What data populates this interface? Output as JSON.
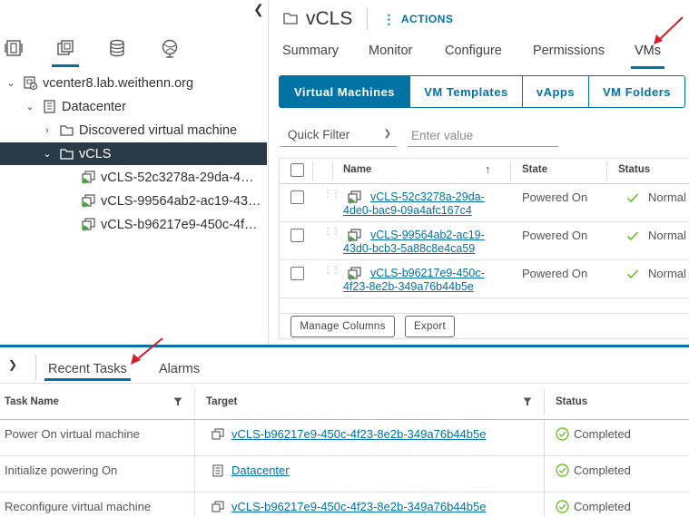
{
  "navigator": {
    "icons": [
      "hosts-and-clusters-icon",
      "vms-and-templates-icon",
      "storage-icon",
      "networking-icon"
    ],
    "tree": [
      {
        "label": "vcenter8.lab.weithenn.org",
        "type": "vcenter",
        "expanded": true
      },
      {
        "label": "Datacenter",
        "type": "datacenter",
        "expanded": true
      },
      {
        "label": "Discovered virtual machine",
        "type": "folder",
        "expanded": false
      },
      {
        "label": "vCLS",
        "type": "folder",
        "expanded": true,
        "selected": true
      },
      {
        "label": "vCLS-52c3278a-29da-4…",
        "type": "vm"
      },
      {
        "label": "vCLS-99564ab2-ac19-43…",
        "type": "vm"
      },
      {
        "label": "vCLS-b96217e9-450c-4f…",
        "type": "vm"
      }
    ]
  },
  "header": {
    "title": "vCLS",
    "actions_label": "ACTIONS"
  },
  "tabs": [
    "Summary",
    "Monitor",
    "Configure",
    "Permissions",
    "VMs"
  ],
  "active_tab": "VMs",
  "subtabs": [
    "Virtual Machines",
    "VM Templates",
    "vApps",
    "VM Folders"
  ],
  "active_subtab": "Virtual Machines",
  "filter": {
    "select_value": "Quick Filter",
    "placeholder": "Enter value"
  },
  "vm_table": {
    "columns": {
      "name": "Name",
      "state": "State",
      "status": "Status"
    },
    "rows": [
      {
        "name": "vCLS-52c3278a-29da-4de0-bac9-09a4afc167c4",
        "state": "Powered On",
        "status": "Normal"
      },
      {
        "name": "vCLS-99564ab2-ac19-43d0-bcb3-5a88c8e4ca59",
        "state": "Powered On",
        "status": "Normal"
      },
      {
        "name": "vCLS-b96217e9-450c-4f23-8e2b-349a76b44b5e",
        "state": "Powered On",
        "status": "Normal"
      }
    ],
    "buttons": {
      "manage_columns": "Manage Columns",
      "export": "Export"
    }
  },
  "bottom": {
    "tabs": [
      "Recent Tasks",
      "Alarms"
    ],
    "active_tab": "Recent Tasks",
    "columns": {
      "task_name": "Task Name",
      "target": "Target",
      "status": "Status"
    },
    "rows": [
      {
        "task": "Power On virtual machine",
        "target": "vCLS-b96217e9-450c-4f23-8e2b-349a76b44b5e",
        "target_type": "vm",
        "status": "Completed"
      },
      {
        "task": "Initialize powering On",
        "target": "Datacenter",
        "target_type": "datacenter",
        "status": "Completed"
      },
      {
        "task": "Reconfigure virtual machine",
        "target": "vCLS-b96217e9-450c-4f23-8e2b-349a76b44b5e",
        "target_type": "vm",
        "status": "Completed"
      }
    ]
  },
  "colors": {
    "accent": "#0072a3",
    "selected_row": "#2a3a46",
    "annotation_arrow": "#d0202a",
    "ok_green": "#5eb715"
  }
}
